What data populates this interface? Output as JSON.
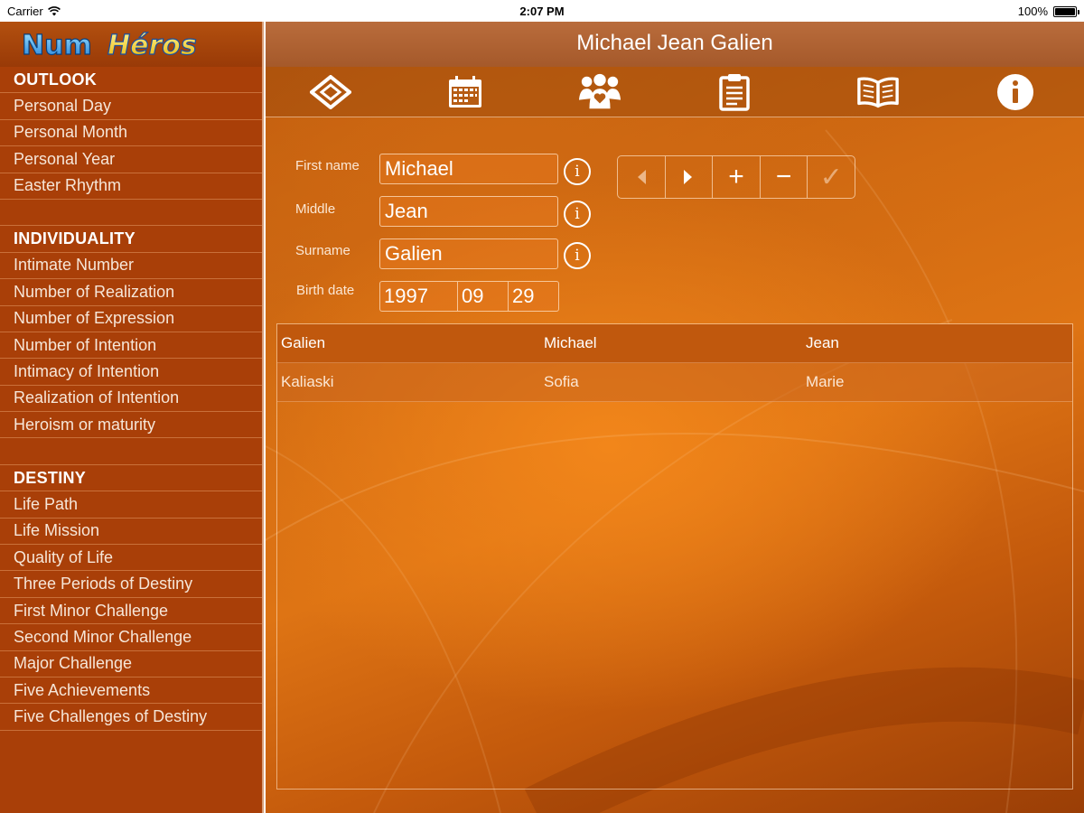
{
  "status": {
    "carrier": "Carrier",
    "time": "2:07 PM",
    "battery": "100%",
    "battery_level": 1.0
  },
  "app": {
    "logo": "NumHéros",
    "window_title": "Michael Jean Galien"
  },
  "sidebar": {
    "sections": [
      {
        "header": "OUTLOOK",
        "items": [
          "Personal Day",
          "Personal Month",
          "Personal Year",
          "Easter Rhythm"
        ]
      },
      {
        "header": "INDIVIDUALITY",
        "items": [
          "Intimate Number",
          "Number of Realization",
          "Number of Expression",
          "Number of Intention",
          "Intimacy of Intention",
          "Realization of Intention",
          "Heroism or maturity"
        ]
      },
      {
        "header": "DESTINY",
        "items": [
          "Life Path",
          "Life Mission",
          "Quality of Life",
          "Three Periods of Destiny",
          "First Minor Challenge",
          "Second Minor Challenge",
          "Major Challenge",
          "Five Achievements",
          "Five Challenges of Destiny"
        ]
      }
    ]
  },
  "toolbar": {
    "icons": [
      "diamond-icon",
      "calendar-icon",
      "people-heart-icon",
      "clipboard-icon",
      "book-icon",
      "info-icon"
    ]
  },
  "form": {
    "first_name_label": "First name",
    "first_name_value": "Michael",
    "middle_label": "Middle",
    "middle_value": "Jean",
    "surname_label": "Surname",
    "surname_value": "Galien",
    "birth_date_label": "Birth date",
    "birth_year": "1997",
    "birth_month": "09",
    "birth_day": "29",
    "info_glyph": "i"
  },
  "nav": {
    "prev": "◀",
    "next": "▶",
    "add": "+",
    "remove": "−",
    "confirm": "✓"
  },
  "people": [
    {
      "surname": "Galien",
      "first": "Michael",
      "middle": "Jean",
      "selected": true
    },
    {
      "surname": "Kaliaski",
      "first": "Sofia",
      "middle": "Marie",
      "selected": false
    }
  ],
  "colors": {
    "sidebar": "#a93f08",
    "accent": "#de7414",
    "selected_row": "#c0580d"
  }
}
